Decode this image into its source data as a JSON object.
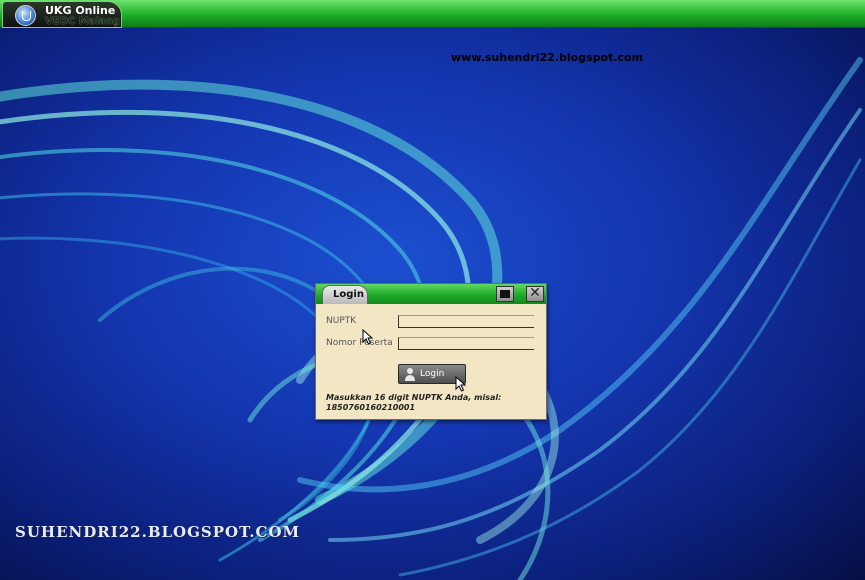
{
  "taskbar": {
    "app_title": "UKG Online",
    "app_subtitle": "VEDC Malang"
  },
  "watermarks": {
    "top": "www.suhendri22.blogspot.com",
    "bottom": "SUHENDRI22.BLOGSPOT.COM"
  },
  "login_dialog": {
    "title": "Login",
    "nuptk_label": "NUPTK",
    "nuptk_value": "",
    "nomor_label": "Nomor Peserta",
    "nomor_value": "",
    "login_button": "Login",
    "hint": "Masukkan 16 digit NUPTK Anda, misal: 1850760160210001"
  },
  "colors": {
    "taskbar_green": "#1fae2a",
    "dialog_bg": "#f2e6c4",
    "desktop_blue": "#1436b0"
  },
  "icons": [
    "app-logo-icon",
    "minimize-icon",
    "close-icon",
    "user-icon",
    "mouse-pointer-icon"
  ]
}
